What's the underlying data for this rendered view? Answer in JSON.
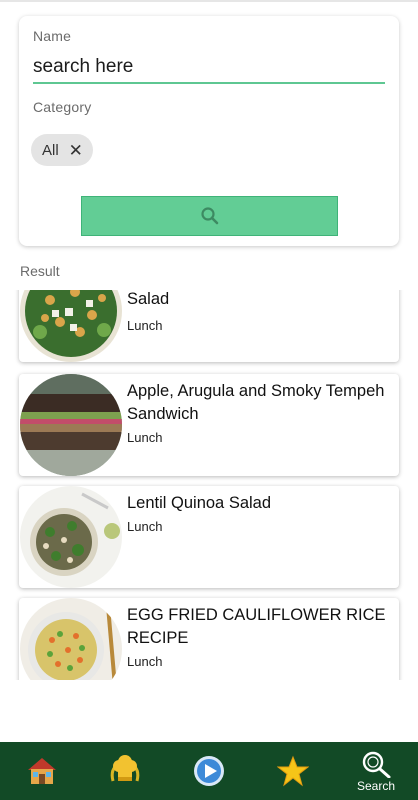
{
  "search": {
    "name_label": "Name",
    "name_placeholder": "search here",
    "category_label": "Category",
    "category_chip": "All",
    "chip_remove": "✕"
  },
  "results": {
    "label": "Result",
    "items": [
      {
        "title": "Salad",
        "category": "Lunch"
      },
      {
        "title": "Apple, Arugula and Smoky Tempeh Sandwich",
        "category": "Lunch"
      },
      {
        "title": "Lentil Quinoa Salad",
        "category": "Lunch"
      },
      {
        "title": "EGG FRIED CAULIFLOWER RICE RECIPE",
        "category": "Lunch"
      }
    ]
  },
  "bottom_nav": {
    "items": [
      {
        "icon": "house-icon"
      },
      {
        "icon": "chef-hat-icon"
      },
      {
        "icon": "play-icon"
      },
      {
        "icon": "star-icon"
      },
      {
        "icon": "search-icon",
        "label": "Search"
      }
    ]
  },
  "colors": {
    "accent": "#5ec792",
    "button": "#62cd95",
    "nav_bar": "#124a26"
  }
}
